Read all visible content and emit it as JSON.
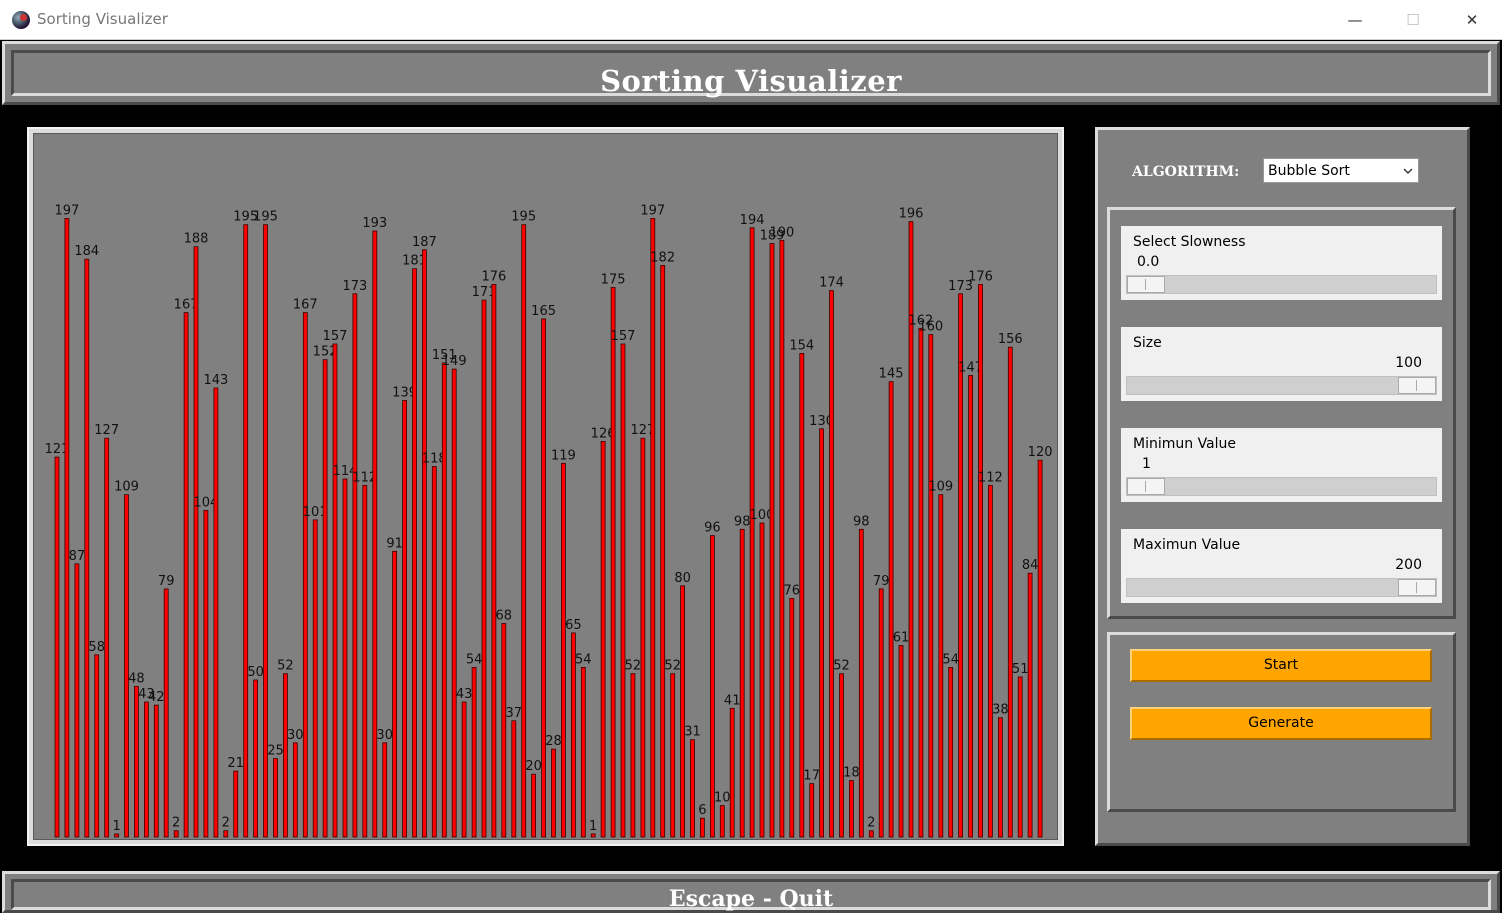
{
  "window": {
    "title": "Sorting Visualizer"
  },
  "header": {
    "title": "Sorting Visualizer"
  },
  "footer": {
    "hint": "Escape - Quit"
  },
  "controls": {
    "algorithm_label": "ALGORITHM:",
    "algorithm_selected": "Bubble Sort",
    "sliders": [
      {
        "label": "Select Slowness",
        "value": "0.0",
        "fraction": 0.0
      },
      {
        "label": "Size",
        "value": "100",
        "fraction": 1.0
      },
      {
        "label": "Minimun Value",
        "value": "1",
        "fraction": 0.0
      },
      {
        "label": "Maximun Value",
        "value": "200",
        "fraction": 1.0
      }
    ],
    "start_label": "Start",
    "generate_label": "Generate"
  },
  "colors": {
    "bar": "#ff0000",
    "panel": "#808080",
    "button": "#ffa500"
  },
  "icons": [
    "app-icon",
    "minimize-icon",
    "maximize-icon",
    "close-icon",
    "chevron-down-icon"
  ],
  "chart_data": {
    "type": "bar",
    "ylim": [
      0,
      200
    ],
    "values": [
      121,
      197,
      87,
      184,
      58,
      127,
      1,
      109,
      48,
      43,
      42,
      79,
      2,
      167,
      188,
      104,
      143,
      2,
      21,
      195,
      50,
      195,
      25,
      52,
      30,
      167,
      101,
      152,
      157,
      114,
      173,
      112,
      193,
      30,
      91,
      139,
      181,
      187,
      118,
      151,
      149,
      43,
      54,
      171,
      176,
      68,
      37,
      195,
      20,
      165,
      28,
      119,
      65,
      54,
      1,
      126,
      175,
      157,
      52,
      127,
      197,
      182,
      52,
      80,
      31,
      6,
      96,
      10,
      41,
      98,
      194,
      100,
      189,
      190,
      76,
      154,
      17,
      130,
      174,
      52,
      18,
      98,
      2,
      79,
      145,
      61,
      196,
      162,
      160,
      109,
      54,
      173,
      147,
      176,
      112,
      38,
      156,
      51,
      84,
      120
    ]
  }
}
